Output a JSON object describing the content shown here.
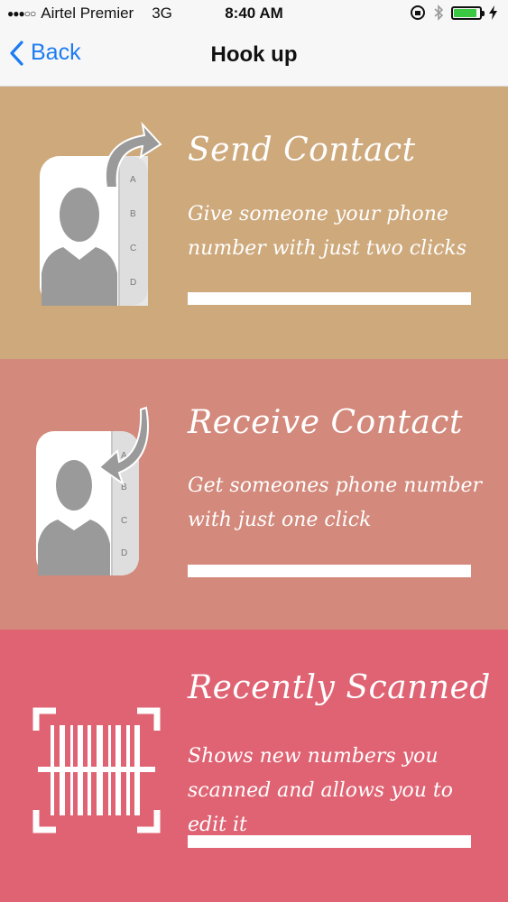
{
  "status_bar": {
    "carrier": "Airtel Premier",
    "network": "3G",
    "time": "8:40 AM",
    "battery_color": "#3bc843",
    "battery_level": 0.9
  },
  "nav": {
    "back_label": "Back",
    "title": "Hook up"
  },
  "cards": [
    {
      "title": "Send Contact",
      "description": "Give someone your phone number with just two clicks",
      "color": "#cea97c",
      "icon": "contacts-send-icon",
      "tabs": [
        "A",
        "B",
        "C",
        "D"
      ]
    },
    {
      "title": "Receive Contact",
      "description": "Get someones phone number with just one click",
      "color": "#d3897b",
      "icon": "contacts-receive-icon",
      "tabs": [
        "A",
        "B",
        "C",
        "D"
      ]
    },
    {
      "title": "Recently Scanned",
      "description": "Shows new numbers you scanned and allows you to edit it",
      "color": "#df6373",
      "icon": "barcode-scan-icon"
    }
  ]
}
